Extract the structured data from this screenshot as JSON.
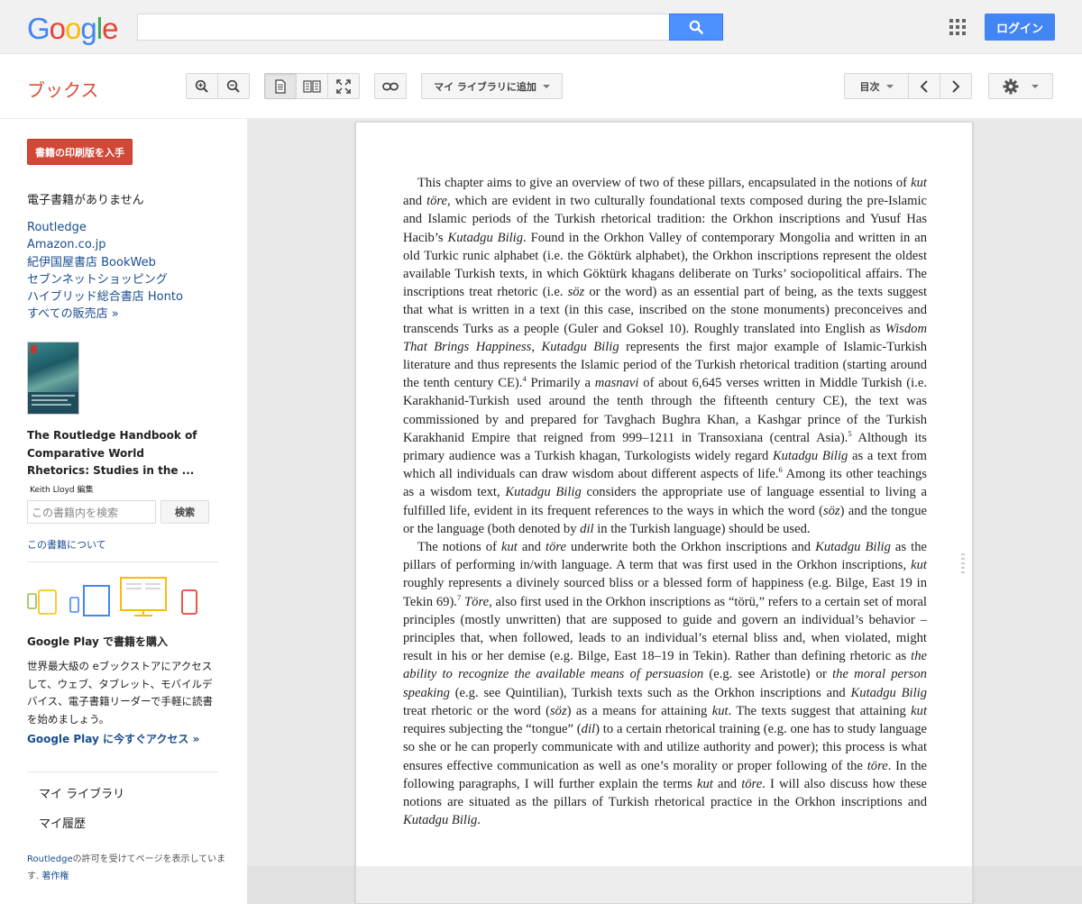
{
  "header": {
    "logo_letters": [
      {
        "ch": "G",
        "color": "#4285f4"
      },
      {
        "ch": "o",
        "color": "#ea4335"
      },
      {
        "ch": "o",
        "color": "#fbbc05"
      },
      {
        "ch": "g",
        "color": "#4285f4"
      },
      {
        "ch": "l",
        "color": "#34a853"
      },
      {
        "ch": "e",
        "color": "#ea4335"
      }
    ],
    "search_value": "",
    "search_icon": "search-icon",
    "apps_icon": "apps-grid-icon",
    "login_label": "ログイン"
  },
  "toolbar": {
    "brand": "ブックス",
    "zoom_in_icon": "zoom-in-icon",
    "zoom_out_icon": "zoom-out-icon",
    "single_page_icon": "single-page-view-icon",
    "two_page_icon": "two-page-view-icon",
    "fullscreen_icon": "fullscreen-icon",
    "link_icon": "link-icon",
    "add_library_label": "マイ ライブラリに追加",
    "toc_label": "目次",
    "settings_icon": "gear-icon"
  },
  "sidebar": {
    "print_button": "書籍の印刷版を入手",
    "no_ebook": "電子書籍がありません",
    "sellers": [
      "Routledge",
      "Amazon.co.jp",
      "紀伊国屋書店 BookWeb",
      "セブンネットショッピング",
      "ハイブリッド総合書店 Honto",
      "すべての販売店 »"
    ],
    "book_title": "The Routledge Handbook of Comparative World Rhetorics: Studies in the ...",
    "editor": "Keith Lloyd 編集",
    "search_placeholder": "この書籍内を検索",
    "search_button": "検索",
    "about_link": "この書籍について",
    "play_heading": "Google Play で書籍を購入",
    "play_description": "世界最大級の eブックストアにアクセスして、ウェブ、タブレット、モバイルデバイス、電子書籍リーダーで手軽に読書を始めましょう。",
    "play_link": "Google Play に今すぐアクセス »",
    "my_library": "マイ ライブラリ",
    "my_history": "マイ履歴",
    "permission_publisher": "Routledge",
    "permission_text": "の許可を受けてページを表示しています. ",
    "permission_link": "著作権"
  }
}
